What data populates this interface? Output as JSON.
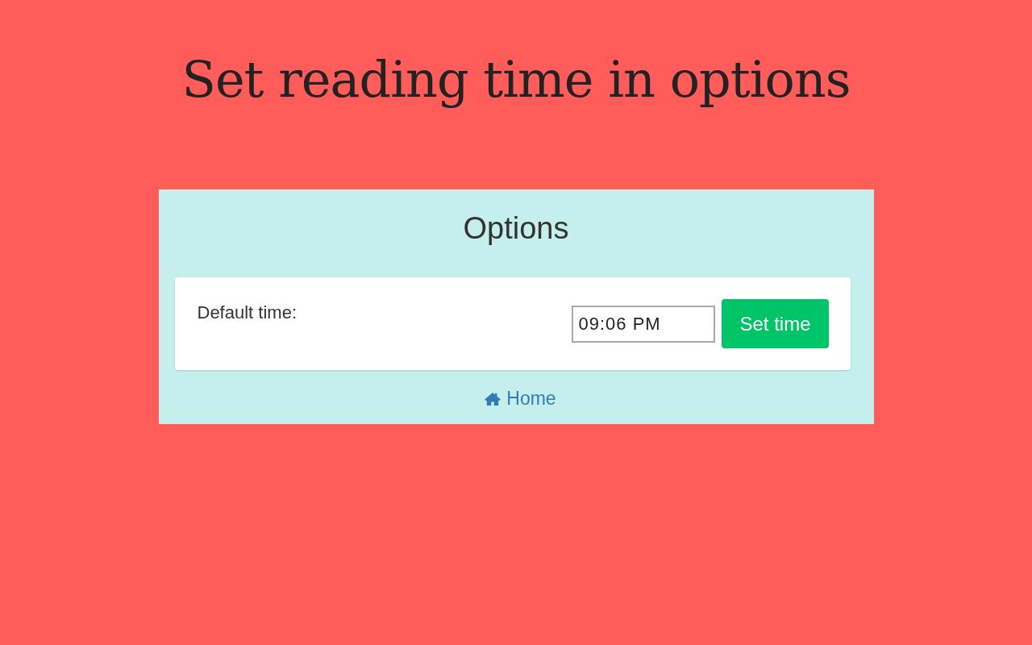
{
  "headline": "Set reading time in options",
  "panel": {
    "title": "Options",
    "setting": {
      "label": "Default time:",
      "value": "09:06 PM",
      "button": "Set time"
    },
    "home_link": "Home"
  }
}
